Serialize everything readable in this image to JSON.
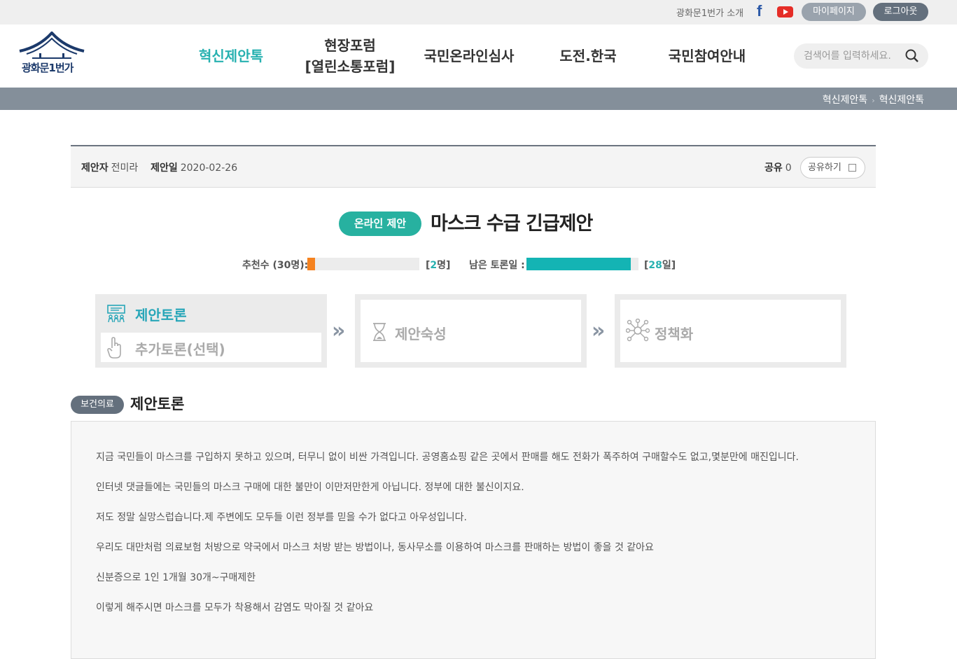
{
  "topbar": {
    "intro_label": "광화문1번가 소개",
    "facebook_glyph": "f",
    "mypage_label": "마이페이지",
    "logout_label": "로그아웃"
  },
  "logo": {
    "text": "광화문1번가"
  },
  "nav": {
    "items": [
      {
        "label": "혁신제안톡",
        "active": true
      },
      {
        "label": "현장포럼",
        "label2": "[열린소통포럼]"
      },
      {
        "label": "국민온라인심사"
      },
      {
        "label": "도전.한국"
      },
      {
        "label": "국민참여안내"
      }
    ]
  },
  "search": {
    "placeholder": "검색어를 입력하세요."
  },
  "breadcrumb": [
    "혁신제안톡",
    "혁신제안톡"
  ],
  "proposal": {
    "proposer_label": "제안자",
    "proposer": "전미라",
    "date_label": "제안일",
    "date": "2020-02-26",
    "share_label": "공유",
    "share_count": "0",
    "share_button": "공유하기",
    "type_badge": "온라인 제안",
    "title": "마스크 수급 긴급제안"
  },
  "stats": {
    "recommend_label": "추천수 (30명):",
    "recommend_open": "[",
    "recommend_value": "2",
    "recommend_close": "명]",
    "recommend_fraction": 0.067,
    "days_label": "남은 토론일 :",
    "days_open": "[",
    "days_value": "28",
    "days_close": "일]",
    "days_fraction": 0.93,
    "colors": {
      "recommend": "#f5821f",
      "days": "#14b4b4"
    }
  },
  "steps": {
    "step1": "제안토론",
    "step1_sub": "추가토론(선택)",
    "step2": "제안숙성",
    "step3": "정책화",
    "arrow": "»"
  },
  "content": {
    "category": "보건의료",
    "heading": "제안토론",
    "paragraphs": [
      "지금 국민들이 마스크를 구입하지 못하고 있으며, 터무니 없이 비싼 가격입니다. 공영홈쇼핑 같은 곳에서 판매를 해도 전화가 폭주하여 구매할수도 없고,몇분만에 매진입니다.",
      "인터넷 댓글들에는 국민들의 마스크 구매에 대한 불만이 이만저만한게 아닙니다. 정부에 대한 불신이지요.",
      "저도 정말 실망스럽습니다.제 주변에도 모두들 이런 정부를 믿을 수가 없다고 아우성입니다.",
      "우리도 대만처럼 의료보험 처방으로 약국에서 마스크 처방 받는 방법이나, 동사무소를 이용하여 마스크를 판매하는 방법이 좋을 것 같아요",
      "신분증으로 1인 1개월 30개~구매제한",
      "이렇게 해주시면 마스크를 모두가 착용해서 감염도 막아질 것 같아요"
    ]
  }
}
